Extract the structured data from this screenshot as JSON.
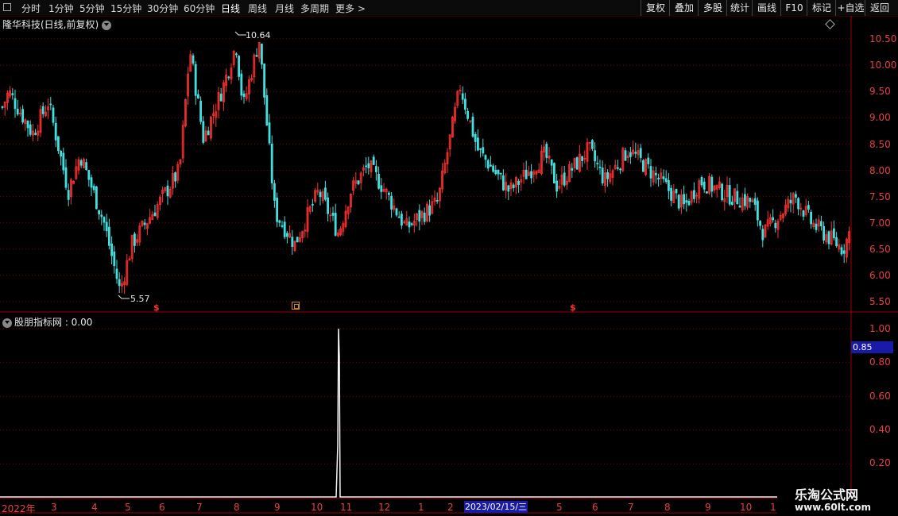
{
  "toolbar": {
    "tabs": [
      "分时",
      "1分钟",
      "5分钟",
      "15分钟",
      "30分钟",
      "60分钟",
      "日线",
      "周线",
      "月线",
      "多周期",
      "更多 >"
    ],
    "active_tab": "日线",
    "right_buttons": [
      "复权",
      "叠加",
      "多股",
      "统计",
      "画线",
      "F10",
      "标记",
      "+自选",
      "返回"
    ]
  },
  "main_panel": {
    "title": "隆华科技(日线,前复权)",
    "high_label": "10.64",
    "low_label": "5.57",
    "signal_marker": "$",
    "y_ticks": [
      "10.50",
      "10.00",
      "9.50",
      "9.00",
      "8.50",
      "8.00",
      "7.50",
      "7.00",
      "6.50",
      "6.00",
      "5.50"
    ]
  },
  "indicator_panel": {
    "title": "股朋指标网 : 0.00",
    "y_ticks": [
      "1.00",
      "0.80",
      "0.60",
      "0.40",
      "0.20"
    ],
    "cursor_value": "0.85"
  },
  "x_axis": {
    "labels": [
      "2022年",
      "3",
      "4",
      "5",
      "6",
      "7",
      "8",
      "9",
      "10",
      "11",
      "12",
      "1",
      "2",
      "5",
      "6",
      "7",
      "8",
      "9",
      "10",
      "1"
    ],
    "cursor_date": "2023/02/15/三"
  },
  "watermark": {
    "line1": "乐淘公式网",
    "line2": "www.60lt.com"
  },
  "colors": {
    "up": "#ff3030",
    "down": "#40e0e0",
    "axis": "#a00000",
    "grid": "#7a0000"
  }
}
